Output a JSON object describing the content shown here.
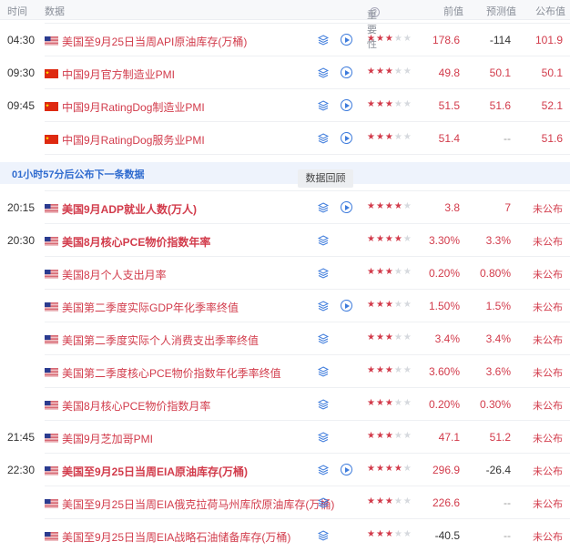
{
  "header": {
    "time": "时间",
    "data": "数据",
    "importance": "重要性",
    "previous": "前值",
    "forecast": "预测值",
    "actual": "公布值"
  },
  "banner": "01小时57分后公布下一条数据",
  "tooltip": "数据回顾",
  "colors": {
    "accent_red": "#d23b4b",
    "link_blue": "#2f6bcf",
    "star_off": "#d6d9de"
  },
  "rows": [
    {
      "time": "04:30",
      "flag": "us-flag",
      "title": "美国至9月25日当周API原油库存(万桶)",
      "bold": false,
      "layers": true,
      "play": true,
      "stars": 3,
      "prev": "178.6",
      "forecast": "-114",
      "actual": "101.9"
    },
    {
      "time": "09:30",
      "flag": "cn-flag",
      "title": "中国9月官方制造业PMI",
      "bold": false,
      "layers": true,
      "play": true,
      "stars": 3,
      "prev": "49.8",
      "forecast": "50.1",
      "actual": "50.1"
    },
    {
      "time": "09:45",
      "flag": "cn-flag",
      "title": "中国9月RatingDog制造业PMI",
      "bold": false,
      "layers": true,
      "play": true,
      "stars": 3,
      "prev": "51.5",
      "forecast": "51.6",
      "actual": "52.1"
    },
    {
      "time": "",
      "flag": "cn-flag",
      "title": "中国9月RatingDog服务业PMI",
      "bold": false,
      "layers": true,
      "play": true,
      "stars": 3,
      "prev": "51.4",
      "forecast": "--",
      "actual": "51.6"
    },
    {
      "time": "20:15",
      "flag": "us-flag",
      "title": "美国9月ADP就业人数(万人)",
      "bold": true,
      "layers": true,
      "play": true,
      "stars": 4,
      "prev": "3.8",
      "forecast": "7",
      "actual": "未公布"
    },
    {
      "time": "20:30",
      "flag": "us-flag",
      "title": "美国8月核心PCE物价指数年率",
      "bold": true,
      "layers": true,
      "play": false,
      "stars": 4,
      "prev": "3.30%",
      "forecast": "3.3%",
      "actual": "未公布"
    },
    {
      "time": "",
      "flag": "us-flag",
      "title": "美国8月个人支出月率",
      "bold": false,
      "layers": true,
      "play": false,
      "stars": 3,
      "prev": "0.20%",
      "forecast": "0.80%",
      "actual": "未公布"
    },
    {
      "time": "",
      "flag": "us-flag",
      "title": "美国第二季度实际GDP年化季率终值",
      "bold": false,
      "layers": true,
      "play": true,
      "stars": 3,
      "prev": "1.50%",
      "forecast": "1.5%",
      "actual": "未公布"
    },
    {
      "time": "",
      "flag": "us-flag",
      "title": "美国第二季度实际个人消费支出季率终值",
      "bold": false,
      "layers": true,
      "play": false,
      "stars": 3,
      "prev": "3.4%",
      "forecast": "3.4%",
      "actual": "未公布"
    },
    {
      "time": "",
      "flag": "us-flag",
      "title": "美国第二季度核心PCE物价指数年化季率终值",
      "bold": false,
      "layers": true,
      "play": false,
      "stars": 3,
      "prev": "3.60%",
      "forecast": "3.6%",
      "actual": "未公布"
    },
    {
      "time": "",
      "flag": "us-flag",
      "title": "美国8月核心PCE物价指数月率",
      "bold": false,
      "layers": true,
      "play": false,
      "stars": 3,
      "prev": "0.20%",
      "forecast": "0.30%",
      "actual": "未公布"
    },
    {
      "time": "21:45",
      "flag": "us-flag",
      "title": "美国9月芝加哥PMI",
      "bold": false,
      "layers": true,
      "play": false,
      "stars": 3,
      "prev": "47.1",
      "forecast": "51.2",
      "actual": "未公布"
    },
    {
      "time": "22:30",
      "flag": "us-flag",
      "title": "美国至9月25日当周EIA原油库存(万桶)",
      "bold": true,
      "layers": true,
      "play": true,
      "stars": 4,
      "prev": "296.9",
      "forecast": "-26.4",
      "actual": "未公布"
    },
    {
      "time": "",
      "flag": "us-flag",
      "title": "美国至9月25日当周EIA俄克拉荷马州库欣原油库存(万桶)",
      "bold": false,
      "layers": true,
      "play": false,
      "stars": 3,
      "prev": "226.6",
      "forecast": "--",
      "actual": "未公布"
    },
    {
      "time": "",
      "flag": "us-flag",
      "title": "美国至9月25日当周EIA战略石油储备库存(万桶)",
      "bold": false,
      "layers": true,
      "play": false,
      "stars": 3,
      "prev": "-40.5",
      "forecast": "--",
      "actual": "未公布"
    }
  ]
}
